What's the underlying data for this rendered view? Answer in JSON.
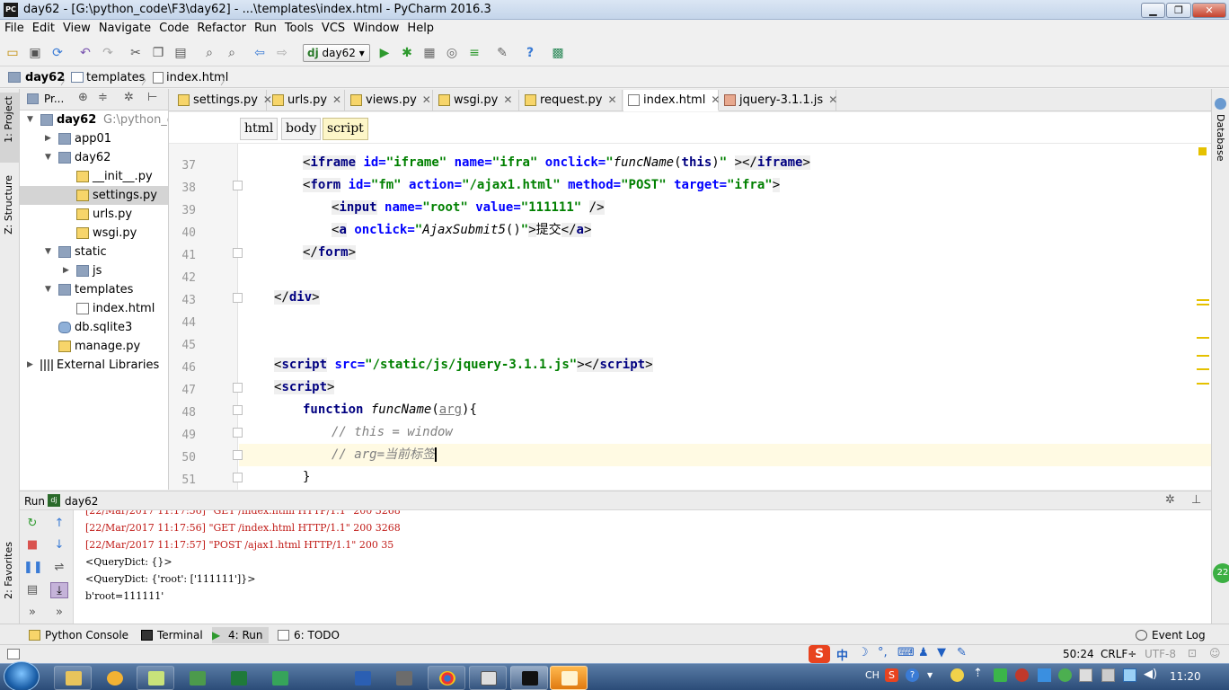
{
  "window": {
    "title": "day62 - [G:\\python_code\\F3\\day62] - ...\\templates\\index.html - PyCharm 2016.3",
    "app_badge": "PC"
  },
  "menu": [
    "File",
    "Edit",
    "View",
    "Navigate",
    "Code",
    "Refactor",
    "Run",
    "Tools",
    "VCS",
    "Window",
    "Help"
  ],
  "toolbar": {
    "run_config": "day62"
  },
  "nav": {
    "crumbs": [
      "day62",
      "templates",
      "index.html"
    ]
  },
  "left_tabs": {
    "project": "1: Project",
    "structure": "Z: Structure",
    "favorites": "2: Favorites"
  },
  "right_tabs": {
    "database": "Database"
  },
  "project_panel": {
    "header": "Pr...",
    "tree": [
      {
        "label": "day62",
        "extra": "G:\\python_co",
        "depth": 0,
        "expanded": true,
        "icon": "folder-icon"
      },
      {
        "label": "app01",
        "depth": 1,
        "expanded": false,
        "icon": "folder-icon"
      },
      {
        "label": "day62",
        "depth": 1,
        "expanded": true,
        "icon": "folder-icon"
      },
      {
        "label": "__init__.py",
        "depth": 2,
        "icon": "python-file-icon"
      },
      {
        "label": "settings.py",
        "depth": 2,
        "icon": "python-file-icon",
        "selected": true
      },
      {
        "label": "urls.py",
        "depth": 2,
        "icon": "python-file-icon"
      },
      {
        "label": "wsgi.py",
        "depth": 2,
        "icon": "python-file-icon"
      },
      {
        "label": "static",
        "depth": 1,
        "expanded": true,
        "icon": "folder-icon"
      },
      {
        "label": "js",
        "depth": 2,
        "expanded": false,
        "icon": "folder-icon"
      },
      {
        "label": "templates",
        "depth": 1,
        "expanded": true,
        "icon": "folder-icon"
      },
      {
        "label": "index.html",
        "depth": 2,
        "icon": "html-file-icon"
      },
      {
        "label": "db.sqlite3",
        "depth": 1,
        "icon": "database-icon"
      },
      {
        "label": "manage.py",
        "depth": 1,
        "icon": "python-file-icon"
      },
      {
        "label": "External Libraries",
        "depth": 0,
        "expanded": false,
        "icon": "library-icon"
      }
    ]
  },
  "editor_tabs": [
    {
      "label": "settings.py",
      "active": false
    },
    {
      "label": "urls.py",
      "active": false
    },
    {
      "label": "views.py",
      "active": false
    },
    {
      "label": "wsgi.py",
      "active": false
    },
    {
      "label": "request.py",
      "active": false
    },
    {
      "label": "index.html",
      "active": true
    },
    {
      "label": "jquery-3.1.1.js",
      "active": false
    }
  ],
  "tag_breadcrumbs": [
    "html",
    "body",
    "script"
  ],
  "code": {
    "line_numbers": [
      "37",
      "38",
      "39",
      "40",
      "41",
      "42",
      "43",
      "44",
      "45",
      "46",
      "47",
      "48",
      "49",
      "50",
      "51"
    ],
    "current_line": "50"
  },
  "run_panel": {
    "label": "Run",
    "config": "day62",
    "console": [
      "[22/Mar/2017 11:17:56] \"GET /index.html HTTP/1.1\" 200 3268",
      "[22/Mar/2017 11:17:57] \"POST /ajax1.html HTTP/1.1\" 200 35",
      "<QueryDict: {}>",
      "<QueryDict: {'root': ['111111']}>",
      "b'root=111111'"
    ]
  },
  "tool_windows": [
    {
      "label": "Python Console",
      "active": false
    },
    {
      "label": "Terminal",
      "active": false
    },
    {
      "label": "4: Run",
      "active": true
    },
    {
      "label": "6: TODO",
      "active": false
    }
  ],
  "event_log": "Event Log",
  "status": {
    "position": "50:24",
    "line_sep": "CRLF÷",
    "encoding": "UTF-8"
  },
  "ime": {
    "lang": "中",
    "taskbar_lang": "CH"
  },
  "clock": "11:20",
  "notification_count": "22"
}
